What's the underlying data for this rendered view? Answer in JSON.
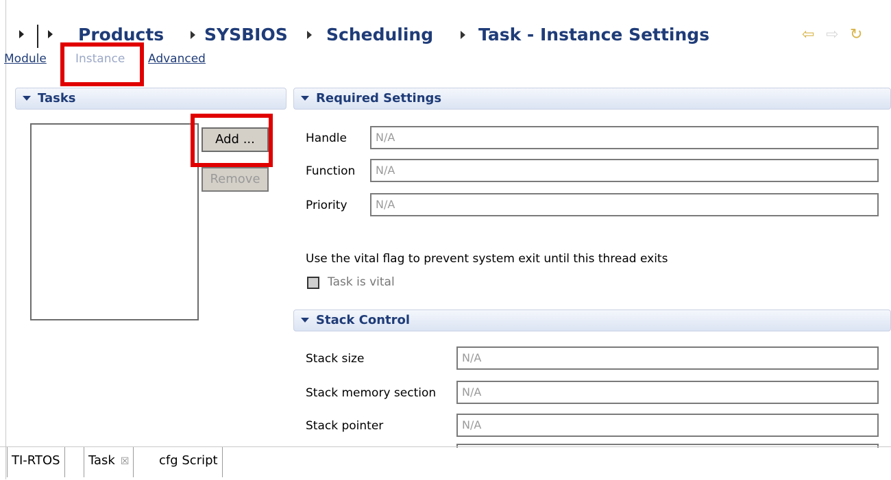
{
  "breadcrumb": {
    "items": [
      "Products",
      "SYSBIOS",
      "Scheduling",
      "Task - Instance Settings"
    ]
  },
  "nav": {
    "back_icon": "back-arrow-icon",
    "forward_icon": "forward-arrow-icon",
    "refresh_icon": "refresh-icon"
  },
  "page_tabs": {
    "module": "Module",
    "instance": "Instance",
    "advanced": "Advanced"
  },
  "tasks": {
    "title": "Tasks",
    "add_label": "Add ...",
    "remove_label": "Remove"
  },
  "required": {
    "title": "Required Settings",
    "handle_label": "Handle",
    "handle_value": "N/A",
    "function_label": "Function",
    "function_value": "N/A",
    "priority_label": "Priority",
    "priority_value": "N/A",
    "vital_info": "Use the vital flag to prevent system exit until this thread exits",
    "vital_checkbox_label": "Task is vital"
  },
  "stack": {
    "title": "Stack Control",
    "size_label": "Stack size",
    "size_value": "N/A",
    "section_label": "Stack memory section",
    "section_value": "N/A",
    "pointer_label": "Stack pointer",
    "pointer_value": "N/A"
  },
  "bottom_tabs": {
    "tab1": "TI-RTOS",
    "tab2": "Task",
    "tab3": "cfg Script",
    "close_glyph": "☒"
  },
  "colors": {
    "title_blue": "#1f3c78",
    "highlight_red": "#e10000"
  }
}
